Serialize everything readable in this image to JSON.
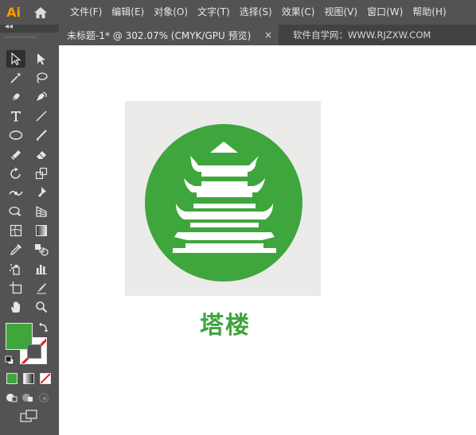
{
  "app": {
    "logo": "Ai"
  },
  "menubar": {
    "items": [
      "文件(F)",
      "编辑(E)",
      "对象(O)",
      "文字(T)",
      "选择(S)",
      "效果(C)",
      "视图(V)",
      "窗口(W)",
      "帮助(H)"
    ]
  },
  "document_tab": {
    "title": "未标题-1* @ 302.07% (CMYK/GPU 预览)",
    "close": "×"
  },
  "watermark": "软件自学网：WWW.RJZXW.COM",
  "toolbar": {
    "collapse": "◂◂",
    "fill_color": "#3fa53d",
    "stroke_color": "none"
  },
  "artwork": {
    "background": "#ebebea",
    "circle_color": "#3ea63c",
    "icon": "pagoda-icon",
    "caption": "塔楼",
    "caption_color": "#3fa53d"
  }
}
